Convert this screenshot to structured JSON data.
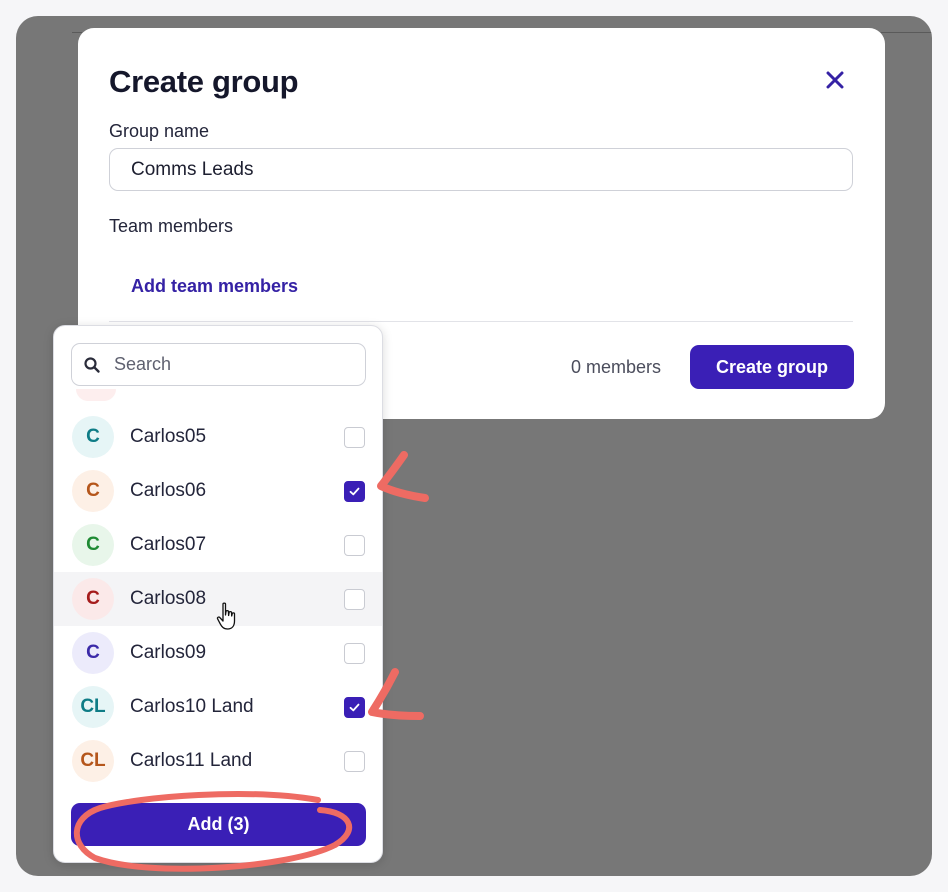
{
  "modal": {
    "title": "Create group",
    "group_name_label": "Group name",
    "group_name_value": "Comms Leads",
    "team_members_label": "Team members",
    "add_members_link": "Add team members",
    "members_count": "0 members",
    "create_button": "Create group"
  },
  "dropdown": {
    "search_placeholder": "Search",
    "items": [
      {
        "initials": "C",
        "name": "Carlos05",
        "checked": false,
        "avatar_bg": "#e6f5f6",
        "avatar_fg": "#0e7c86"
      },
      {
        "initials": "C",
        "name": "Carlos06",
        "checked": true,
        "avatar_bg": "#fdf0e6",
        "avatar_fg": "#b5561b"
      },
      {
        "initials": "C",
        "name": "Carlos07",
        "checked": false,
        "avatar_bg": "#e8f6ea",
        "avatar_fg": "#1f8a34"
      },
      {
        "initials": "C",
        "name": "Carlos08",
        "checked": false,
        "avatar_bg": "#fbe9e9",
        "avatar_fg": "#a51c1c"
      },
      {
        "initials": "C",
        "name": "Carlos09",
        "checked": false,
        "avatar_bg": "#ecebfb",
        "avatar_fg": "#3b2aa8"
      },
      {
        "initials": "CL",
        "name": "Carlos10 Land",
        "checked": true,
        "avatar_bg": "#e6f5f6",
        "avatar_fg": "#0e7c86"
      },
      {
        "initials": "CL",
        "name": "Carlos11 Land",
        "checked": false,
        "avatar_bg": "#fdf0e6",
        "avatar_fg": "#b5561b"
      }
    ],
    "add_button": "Add (3)"
  },
  "colors": {
    "primary": "#3a1fb6",
    "annotation": "#ee6b63"
  }
}
